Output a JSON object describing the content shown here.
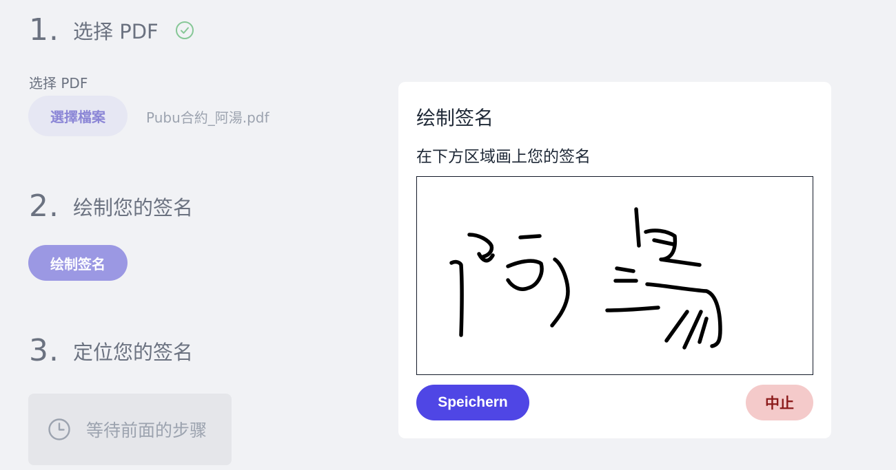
{
  "steps": {
    "step1": {
      "number": "1.",
      "title": "选择 PDF",
      "completed": true
    },
    "step2": {
      "number": "2.",
      "title": "绘制您的签名"
    },
    "step3": {
      "number": "3.",
      "title": "定位您的签名"
    }
  },
  "pdf_select": {
    "label": "选择 PDF",
    "file_button": "選擇檔案",
    "file_name": "Pubu合約_阿湯.pdf"
  },
  "draw": {
    "button": "绘制签名"
  },
  "waiting": {
    "text": "等待前面的步骤"
  },
  "modal": {
    "title": "绘制签名",
    "subtitle": "在下方区域画上您的签名",
    "save_button": "Speichern",
    "abort_button": "中止"
  },
  "colors": {
    "primary": "#4f46e5",
    "primary_light": "#9b98e3",
    "success": "#86c796",
    "danger_bg": "#f4caca",
    "danger_text": "#8b1a1a"
  },
  "icons": {
    "step1_status": "check-circle-icon",
    "waiting": "clock-icon"
  }
}
